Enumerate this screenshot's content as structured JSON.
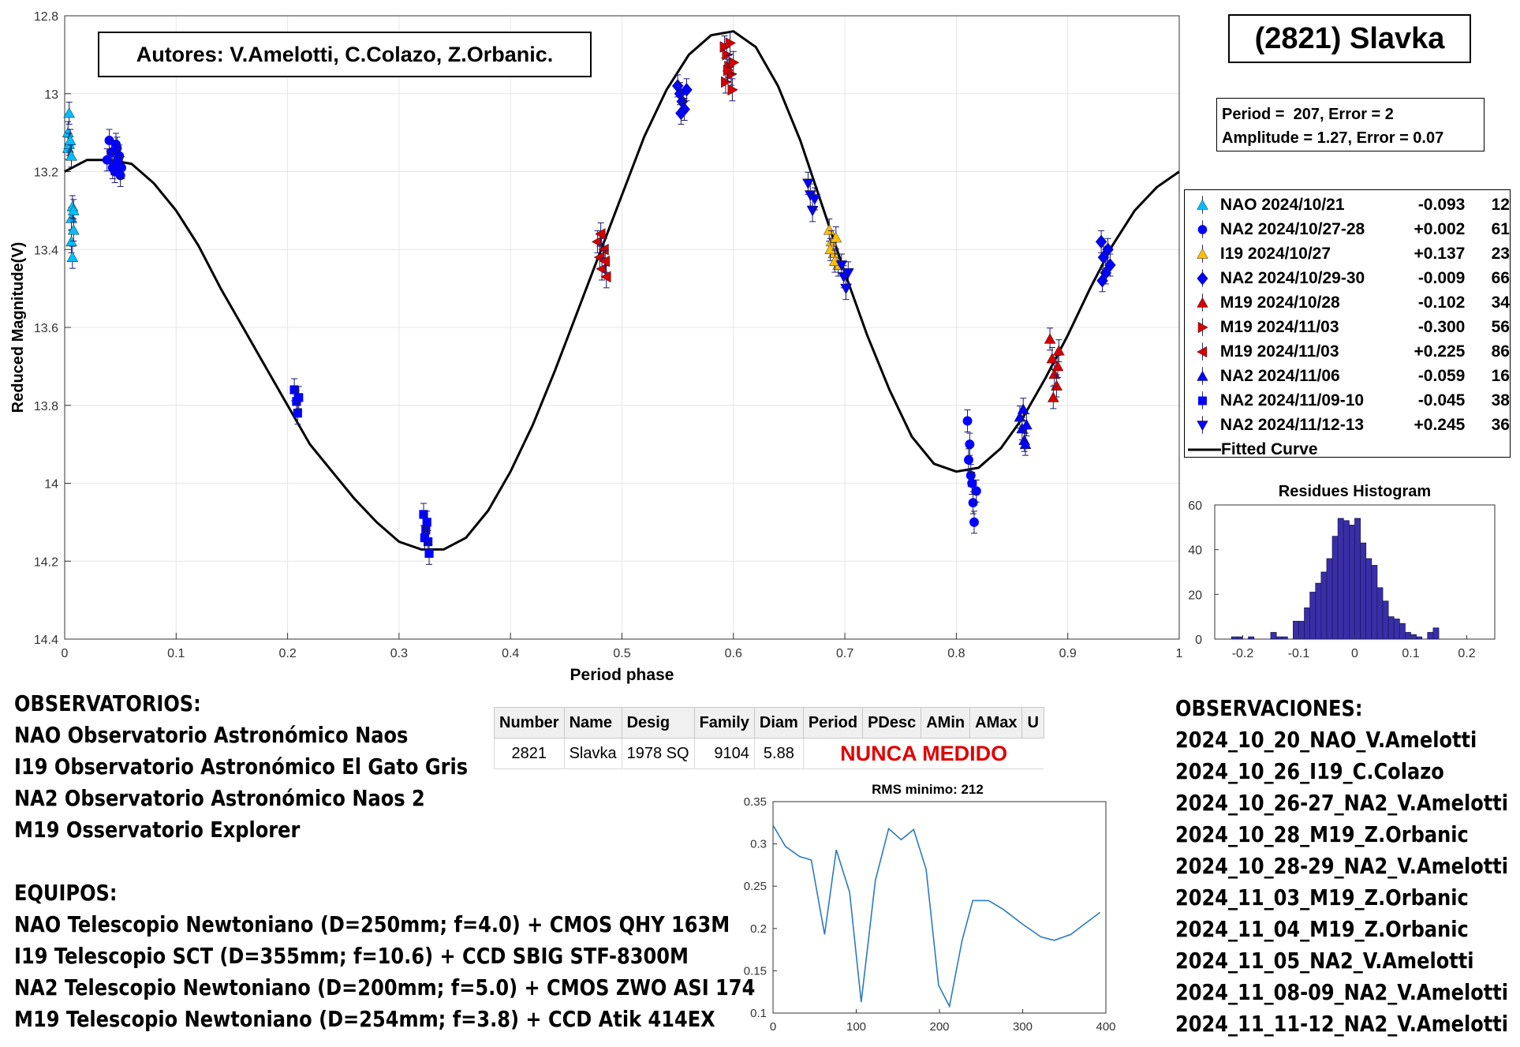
{
  "authors_box": "Autores: V.Amelotti, C.Colazo, Z.Orbanic.",
  "object_title": "(2821) Slavka",
  "fit_info": {
    "line1": "Period =  207, Error = 2",
    "line2": "Amplitude = 1.27, Error = 0.07"
  },
  "legend": [
    {
      "label": "NAO 2024/10/21",
      "offset": "-0.093",
      "count": "12",
      "color": "#00bfff",
      "marker": "triangle-up"
    },
    {
      "label": "NA2 2024/10/27-28",
      "offset": "+0.002",
      "count": "61",
      "color": "#0000ff",
      "marker": "circle"
    },
    {
      "label": "I19 2024/10/27",
      "offset": "+0.137",
      "count": "23",
      "color": "#ffbf00",
      "marker": "triangle-up"
    },
    {
      "label": "NA2 2024/10/29-30",
      "offset": "-0.009",
      "count": "66",
      "color": "#0000ff",
      "marker": "diamond"
    },
    {
      "label": "M19 2024/10/28",
      "offset": "-0.102",
      "count": "34",
      "color": "#d40000",
      "marker": "triangle-up"
    },
    {
      "label": "M19 2024/11/03",
      "offset": "-0.300",
      "count": "56",
      "color": "#d40000",
      "marker": "triangle-right"
    },
    {
      "label": "M19 2024/11/03",
      "offset": "+0.225",
      "count": "86",
      "color": "#d40000",
      "marker": "triangle-left"
    },
    {
      "label": "NA2 2024/11/06",
      "offset": "-0.059",
      "count": "16",
      "color": "#0000ff",
      "marker": "triangle-up"
    },
    {
      "label": "NA2 2024/11/09-10",
      "offset": "-0.045",
      "count": "38",
      "color": "#0000ff",
      "marker": "square"
    },
    {
      "label": "NA2 2024/11/12-13",
      "offset": "+0.245",
      "count": "36",
      "color": "#0000ff",
      "marker": "triangle-down"
    },
    {
      "label": "Fitted Curve",
      "offset": "",
      "count": "",
      "color": "#000000",
      "marker": "line"
    }
  ],
  "observatorios": {
    "heading": "OBSERVATORIOS:",
    "lines": [
      "NAO Observatorio Astronómico Naos",
      "I19 Observatorio Astronómico El Gato Gris",
      "NA2 Observatorio Astronómico Naos 2",
      "M19 Osservatorio Explorer"
    ]
  },
  "equipos": {
    "heading": "EQUIPOS:",
    "lines": [
      "NAO Telescopio Newtoniano (D=250mm; f=4.0) + CMOS QHY 163M",
      "I19 Telescopio SCT (D=355mm; f=10.6) + CCD SBIG STF-8300M",
      "NA2 Telescopio Newtoniano (D=200mm; f=5.0) + CMOS ZWO ASI 174",
      "M19 Telescopio Newtoniano (D=254mm; f=3.8) + CCD Atik 414EX"
    ]
  },
  "observaciones": {
    "heading": "OBSERVACIONES:",
    "lines": [
      "2024_10_20_NAO_V.Amelotti",
      "2024_10_26_I19_C.Colazo",
      "2024_10_26-27_NA2_V.Amelotti",
      "2024_10_28_M19_Z.Orbanic",
      "2024_10_28-29_NA2_V.Amelotti",
      "2024_11_03_M19_Z.Orbanic",
      "2024_11_04_M19_Z.Orbanic",
      "2024_11_05_NA2_V.Amelotti",
      "2024_11_08-09_NA2_V.Amelotti",
      "2024_11_11-12_NA2_V.Amelotti"
    ]
  },
  "catalog_table": {
    "headers": [
      "Number",
      "Name",
      "Desig",
      "Family",
      "Diam",
      "Period",
      "PDesc",
      "AMin",
      "AMax",
      "U"
    ],
    "row": [
      "2821",
      "Slavka",
      "1978 SQ",
      "9104",
      "5.88"
    ],
    "note": "NUNCA MEDIDO",
    "note_color": "#e00000"
  },
  "chart_data": [
    {
      "type": "scatter",
      "title": "",
      "xlabel": "Period phase",
      "ylabel": "Reduced Magnitude(V)",
      "xlim": [
        0,
        1
      ],
      "ylim": [
        14.4,
        12.8
      ],
      "y_reversed": true,
      "grid": true,
      "xticks": [
        "0",
        "0.1",
        "0.2",
        "0.3",
        "0.4",
        "0.5",
        "0.6",
        "0.7",
        "0.8",
        "0.9",
        "1"
      ],
      "yticks": [
        "12.8",
        "13",
        "13.2",
        "13.4",
        "13.6",
        "13.8",
        "14",
        "14.2",
        "14.4"
      ],
      "fitted_curve": {
        "period_hours": 207,
        "amplitude": 1.27,
        "points": [
          [
            0,
            13.2
          ],
          [
            0.02,
            13.17
          ],
          [
            0.04,
            13.17
          ],
          [
            0.06,
            13.18
          ],
          [
            0.08,
            13.23
          ],
          [
            0.1,
            13.3
          ],
          [
            0.12,
            13.39
          ],
          [
            0.14,
            13.5
          ],
          [
            0.16,
            13.6
          ],
          [
            0.18,
            13.7
          ],
          [
            0.2,
            13.8
          ],
          [
            0.22,
            13.9
          ],
          [
            0.24,
            13.97
          ],
          [
            0.26,
            14.04
          ],
          [
            0.28,
            14.1
          ],
          [
            0.3,
            14.15
          ],
          [
            0.32,
            14.17
          ],
          [
            0.34,
            14.17
          ],
          [
            0.36,
            14.14
          ],
          [
            0.38,
            14.07
          ],
          [
            0.4,
            13.97
          ],
          [
            0.42,
            13.85
          ],
          [
            0.44,
            13.71
          ],
          [
            0.46,
            13.56
          ],
          [
            0.48,
            13.41
          ],
          [
            0.5,
            13.26
          ],
          [
            0.52,
            13.11
          ],
          [
            0.54,
            12.99
          ],
          [
            0.56,
            12.9
          ],
          [
            0.58,
            12.85
          ],
          [
            0.6,
            12.84
          ],
          [
            0.62,
            12.88
          ],
          [
            0.64,
            12.98
          ],
          [
            0.66,
            13.12
          ],
          [
            0.68,
            13.29
          ],
          [
            0.7,
            13.46
          ],
          [
            0.72,
            13.62
          ],
          [
            0.74,
            13.76
          ],
          [
            0.76,
            13.88
          ],
          [
            0.78,
            13.95
          ],
          [
            0.8,
            13.97
          ],
          [
            0.82,
            13.96
          ],
          [
            0.84,
            13.91
          ],
          [
            0.86,
            13.83
          ],
          [
            0.88,
            13.73
          ],
          [
            0.9,
            13.62
          ],
          [
            0.92,
            13.5
          ],
          [
            0.94,
            13.39
          ],
          [
            0.96,
            13.3
          ],
          [
            0.98,
            13.24
          ],
          [
            1,
            13.2
          ]
        ]
      },
      "series": [
        {
          "name": "NAO 2024/10/21",
          "color": "#00bfff",
          "marker": "triangle-up",
          "points": [
            [
              0.003,
              13.14
            ],
            [
              0.003,
              13.1
            ],
            [
              0.004,
              13.05
            ],
            [
              0.004,
              13.13
            ],
            [
              0.006,
              13.32
            ],
            [
              0.006,
              13.38
            ],
            [
              0.007,
              13.29
            ],
            [
              0.008,
              13.35
            ],
            [
              0.007,
              13.42
            ],
            [
              0.005,
              13.12
            ],
            [
              0.006,
              13.16
            ],
            [
              0.008,
              13.3
            ]
          ]
        },
        {
          "name": "NA2 2024/10/27-28",
          "color": "#0000ff",
          "marker": "circle",
          "points": [
            [
              0.04,
              13.12
            ],
            [
              0.042,
              13.15
            ],
            [
              0.044,
              13.18
            ],
            [
              0.045,
              13.2
            ],
            [
              0.047,
              13.14
            ],
            [
              0.048,
              13.17
            ],
            [
              0.05,
              13.21
            ],
            [
              0.046,
              13.13
            ],
            [
              0.043,
              13.19
            ],
            [
              0.049,
              13.16
            ],
            [
              0.038,
              13.17
            ],
            [
              0.051,
              13.19
            ],
            [
              0.81,
              13.84
            ],
            [
              0.812,
              13.9
            ],
            [
              0.813,
              13.98
            ],
            [
              0.815,
              14.05
            ],
            [
              0.816,
              14.1
            ],
            [
              0.818,
              14.02
            ],
            [
              0.811,
              13.94
            ],
            [
              0.814,
              14.0
            ]
          ]
        },
        {
          "name": "I19 2024/10/27",
          "color": "#ffbf00",
          "marker": "triangle-up",
          "points": [
            [
              0.686,
              13.35
            ],
            [
              0.688,
              13.38
            ],
            [
              0.69,
              13.41
            ],
            [
              0.692,
              13.37
            ],
            [
              0.694,
              13.44
            ],
            [
              0.687,
              13.4
            ],
            [
              0.691,
              13.43
            ]
          ]
        },
        {
          "name": "NA2 2024/10/29-30",
          "color": "#0000ff",
          "marker": "diamond",
          "points": [
            [
              0.55,
              12.98
            ],
            [
              0.552,
              13.0
            ],
            [
              0.554,
              13.02
            ],
            [
              0.556,
              13.04
            ],
            [
              0.558,
              12.99
            ],
            [
              0.553,
              13.05
            ],
            [
              0.93,
              13.38
            ],
            [
              0.932,
              13.42
            ],
            [
              0.934,
              13.46
            ],
            [
              0.936,
              13.4
            ],
            [
              0.938,
              13.44
            ],
            [
              0.931,
              13.48
            ]
          ]
        },
        {
          "name": "M19 2024/10/28",
          "color": "#d40000",
          "marker": "triangle-up",
          "points": [
            [
              0.884,
              13.63
            ],
            [
              0.886,
              13.68
            ],
            [
              0.888,
              13.72
            ],
            [
              0.89,
              13.75
            ],
            [
              0.892,
              13.66
            ],
            [
              0.887,
              13.78
            ],
            [
              0.891,
              13.7
            ]
          ]
        },
        {
          "name": "M19 2024/11/03",
          "color": "#d40000",
          "marker": "triangle-right",
          "points": [
            [
              0.592,
              12.88
            ],
            [
              0.594,
              12.9
            ],
            [
              0.596,
              12.93
            ],
            [
              0.598,
              12.95
            ],
            [
              0.6,
              12.92
            ],
            [
              0.593,
              12.97
            ],
            [
              0.597,
              12.87
            ],
            [
              0.599,
              12.99
            ],
            [
              0.595,
              12.94
            ]
          ]
        },
        {
          "name": "M19 2024/11/03",
          "color": "#d40000",
          "marker": "triangle-left",
          "points": [
            [
              0.478,
              13.38
            ],
            [
              0.48,
              13.42
            ],
            [
              0.482,
              13.45
            ],
            [
              0.484,
              13.4
            ],
            [
              0.486,
              13.47
            ],
            [
              0.481,
              13.36
            ],
            [
              0.485,
              13.43
            ]
          ]
        },
        {
          "name": "NA2 2024/11/06",
          "color": "#0000ff",
          "marker": "triangle-up",
          "points": [
            [
              0.857,
              13.83
            ],
            [
              0.859,
              13.86
            ],
            [
              0.861,
              13.89
            ],
            [
              0.863,
              13.85
            ],
            [
              0.86,
              13.81
            ],
            [
              0.862,
              13.9
            ]
          ]
        },
        {
          "name": "NA2 2024/11/09-10",
          "color": "#0000ff",
          "marker": "square",
          "points": [
            [
              0.206,
              13.76
            ],
            [
              0.208,
              13.79
            ],
            [
              0.209,
              13.82
            ],
            [
              0.21,
              13.78
            ],
            [
              0.322,
              14.08
            ],
            [
              0.324,
              14.12
            ],
            [
              0.326,
              14.15
            ],
            [
              0.325,
              14.1
            ],
            [
              0.327,
              14.18
            ],
            [
              0.323,
              14.14
            ]
          ]
        },
        {
          "name": "NA2 2024/11/12-13",
          "color": "#0000ff",
          "marker": "triangle-down",
          "points": [
            [
              0.667,
              13.23
            ],
            [
              0.669,
              13.26
            ],
            [
              0.671,
              13.3
            ],
            [
              0.673,
              13.27
            ],
            [
              0.697,
              13.44
            ],
            [
              0.699,
              13.47
            ],
            [
              0.701,
              13.5
            ],
            [
              0.703,
              13.46
            ]
          ]
        }
      ]
    },
    {
      "type": "bar",
      "title": "Residues Histogram",
      "xlim": [
        -0.25,
        0.25
      ],
      "ylim": [
        0,
        60
      ],
      "xticks": [
        "-0.2",
        "-0.1",
        "0",
        "0.1",
        "0.2"
      ],
      "yticks": [
        "0",
        "20",
        "40",
        "60"
      ],
      "bin_width": 0.01,
      "x": [
        -0.215,
        -0.205,
        -0.195,
        -0.185,
        -0.175,
        -0.165,
        -0.155,
        -0.145,
        -0.135,
        -0.125,
        -0.115,
        -0.105,
        -0.095,
        -0.085,
        -0.075,
        -0.065,
        -0.055,
        -0.045,
        -0.035,
        -0.025,
        -0.015,
        -0.005,
        0.005,
        0.015,
        0.025,
        0.035,
        0.045,
        0.055,
        0.065,
        0.075,
        0.085,
        0.095,
        0.105,
        0.115,
        0.125,
        0.135,
        0.145
      ],
      "values": [
        1,
        1,
        0,
        1,
        0,
        0,
        0,
        3,
        1,
        1,
        0,
        8,
        8,
        14,
        21,
        25,
        30,
        36,
        46,
        54,
        53,
        51,
        54,
        43,
        36,
        33,
        23,
        17,
        10,
        9,
        7,
        3,
        2,
        1,
        0,
        3,
        5
      ]
    },
    {
      "type": "line",
      "title": "RMS minimo: 212",
      "xlim": [
        0,
        400
      ],
      "ylim": [
        0.1,
        0.35
      ],
      "xticks": [
        "0",
        "100",
        "200",
        "300",
        "400"
      ],
      "yticks": [
        "0.1",
        "0.15",
        "0.2",
        "0.25",
        "0.3",
        "0.35"
      ],
      "x": [
        0,
        15,
        32,
        46,
        62,
        76,
        92,
        106,
        123,
        139,
        154,
        169,
        184,
        199,
        212,
        227,
        240,
        259,
        276,
        300,
        322,
        338,
        358,
        374,
        393
      ],
      "y": [
        0.322,
        0.297,
        0.285,
        0.281,
        0.193,
        0.293,
        0.243,
        0.113,
        0.257,
        0.318,
        0.305,
        0.317,
        0.27,
        0.133,
        0.108,
        0.185,
        0.233,
        0.233,
        0.223,
        0.205,
        0.19,
        0.186,
        0.193,
        0.205,
        0.219
      ]
    }
  ]
}
